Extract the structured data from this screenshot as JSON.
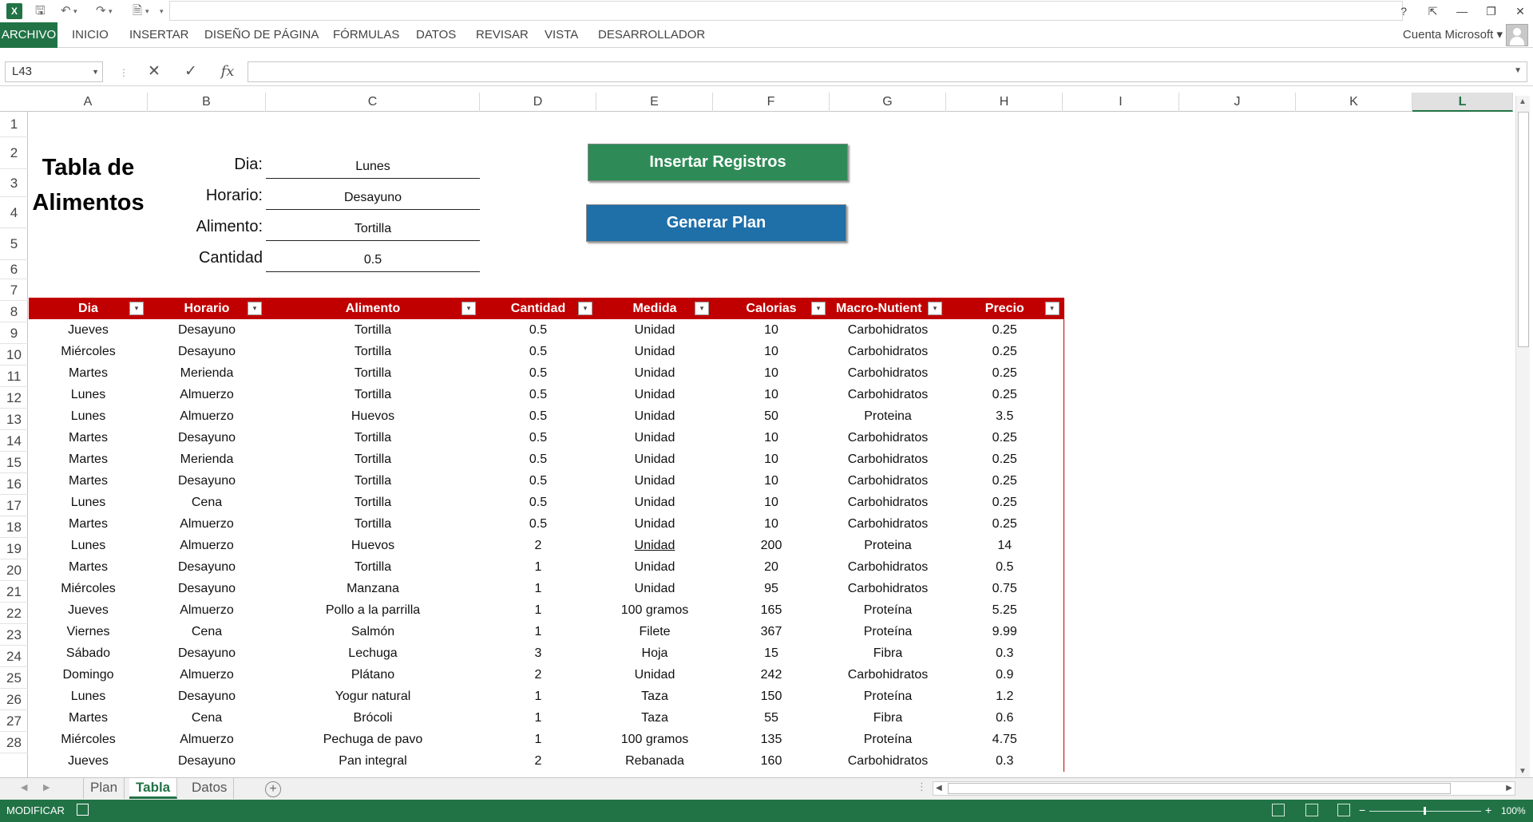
{
  "qat": {
    "logo": "X",
    "save_icon": "save-icon",
    "undo_icon": "undo-icon",
    "redo_icon": "redo-icon",
    "preview_icon": "print-preview-icon"
  },
  "window": {
    "help": "?",
    "restore_ribbon": "⇱",
    "minimize": "—",
    "restore": "❐",
    "close": "✕"
  },
  "ribbon": {
    "tabs": [
      "ARCHIVO",
      "INICIO",
      "INSERTAR",
      "DISEÑO DE PÁGINA",
      "FÓRMULAS",
      "DATOS",
      "REVISAR",
      "VISTA",
      "DESARROLLADOR"
    ],
    "account": "Cuenta Microsoft ▾"
  },
  "formula_bar": {
    "name_box": "L43",
    "cancel": "✕",
    "enter": "✓",
    "fx": "fx",
    "formula": ""
  },
  "columns": [
    "A",
    "B",
    "C",
    "D",
    "E",
    "F",
    "G",
    "H",
    "I",
    "J",
    "K",
    "L"
  ],
  "selected_column": "L",
  "rows": [
    "1",
    "2",
    "3",
    "4",
    "5",
    "6",
    "7",
    "8",
    "9",
    "10",
    "11",
    "12",
    "13",
    "14",
    "15",
    "16",
    "17",
    "18",
    "19",
    "20",
    "21",
    "22",
    "23",
    "24",
    "25",
    "26",
    "27",
    "28"
  ],
  "sheet": {
    "title_line1": "Tabla de",
    "title_line2": "Alimentos",
    "form": {
      "dia_label": "Dia:",
      "dia_value": "Lunes",
      "horario_label": "Horario:",
      "horario_value": "Desayuno",
      "alimento_label": "Alimento:",
      "alimento_value": "Tortilla",
      "cantidad_label": "Cantidad",
      "cantidad_value": "0.5"
    },
    "buttons": {
      "insert": "Insertar Registros",
      "generate": "Generar Plan"
    }
  },
  "table": {
    "headers": [
      "Dia",
      "Horario",
      "Alimento",
      "Cantidad",
      "Medida",
      "Calorias",
      "Macro-Nutient",
      "Precio"
    ],
    "filter_icon": "▾",
    "rows": [
      [
        "Jueves",
        "Desayuno",
        "Tortilla",
        "0.5",
        "Unidad",
        "10",
        "Carbohidratos",
        "0.25"
      ],
      [
        "Miércoles",
        "Desayuno",
        "Tortilla",
        "0.5",
        "Unidad",
        "10",
        "Carbohidratos",
        "0.25"
      ],
      [
        "Martes",
        "Merienda",
        "Tortilla",
        "0.5",
        "Unidad",
        "10",
        "Carbohidratos",
        "0.25"
      ],
      [
        "Lunes",
        "Almuerzo",
        "Tortilla",
        "0.5",
        "Unidad",
        "10",
        "Carbohidratos",
        "0.25"
      ],
      [
        "Lunes",
        "Almuerzo",
        "Huevos",
        "0.5",
        "Unidad",
        "50",
        "Proteina",
        "3.5"
      ],
      [
        "Martes",
        "Desayuno",
        "Tortilla",
        "0.5",
        "Unidad",
        "10",
        "Carbohidratos",
        "0.25"
      ],
      [
        "Martes",
        "Merienda",
        "Tortilla",
        "0.5",
        "Unidad",
        "10",
        "Carbohidratos",
        "0.25"
      ],
      [
        "Martes",
        "Desayuno",
        "Tortilla",
        "0.5",
        "Unidad",
        "10",
        "Carbohidratos",
        "0.25"
      ],
      [
        "Lunes",
        "Cena",
        "Tortilla",
        "0.5",
        "Unidad",
        "10",
        "Carbohidratos",
        "0.25"
      ],
      [
        "Martes",
        "Almuerzo",
        "Tortilla",
        "0.5",
        "Unidad",
        "10",
        "Carbohidratos",
        "0.25"
      ],
      [
        "Lunes",
        "Almuerzo",
        "Huevos",
        "2",
        "Unidad",
        "200",
        "Proteina",
        "14"
      ],
      [
        "Martes",
        "Desayuno",
        "Tortilla",
        "1",
        "Unidad",
        "20",
        "Carbohidratos",
        "0.5"
      ],
      [
        "Miércoles",
        "Desayuno",
        "Manzana",
        "1",
        "Unidad",
        "95",
        "Carbohidratos",
        "0.75"
      ],
      [
        "Jueves",
        "Almuerzo",
        "Pollo a la parrilla",
        "1",
        "100 gramos",
        "165",
        "Proteína",
        "5.25"
      ],
      [
        "Viernes",
        "Cena",
        "Salmón",
        "1",
        "Filete",
        "367",
        "Proteína",
        "9.99"
      ],
      [
        "Sábado",
        "Desayuno",
        "Lechuga",
        "3",
        "Hoja",
        "15",
        "Fibra",
        "0.3"
      ],
      [
        "Domingo",
        "Almuerzo",
        "Plátano",
        "2",
        "Unidad",
        "242",
        "Carbohidratos",
        "0.9"
      ],
      [
        "Lunes",
        "Desayuno",
        "Yogur natural",
        "1",
        "Taza",
        "150",
        "Proteína",
        "1.2"
      ],
      [
        "Martes",
        "Cena",
        "Brócoli",
        "1",
        "Taza",
        "55",
        "Fibra",
        "0.6"
      ],
      [
        "Miércoles",
        "Almuerzo",
        "Pechuga de pavo",
        "1",
        "100 gramos",
        "135",
        "Proteína",
        "4.75"
      ],
      [
        "Jueves",
        "Desayuno",
        "Pan integral",
        "2",
        "Rebanada",
        "160",
        "Carbohidratos",
        "0.3"
      ]
    ]
  },
  "sheet_tabs": [
    "Plan",
    "Tabla",
    "Datos"
  ],
  "active_sheet": "Tabla",
  "add_sheet": "+",
  "status": {
    "mode": "MODIFICAR",
    "zoom_minus": "−",
    "zoom_plus": "+",
    "zoom": "100%"
  },
  "colors": {
    "excel_green": "#217346",
    "header_red": "#C00000",
    "button_green": "#2E8B57",
    "button_blue": "#1F6FA8"
  }
}
